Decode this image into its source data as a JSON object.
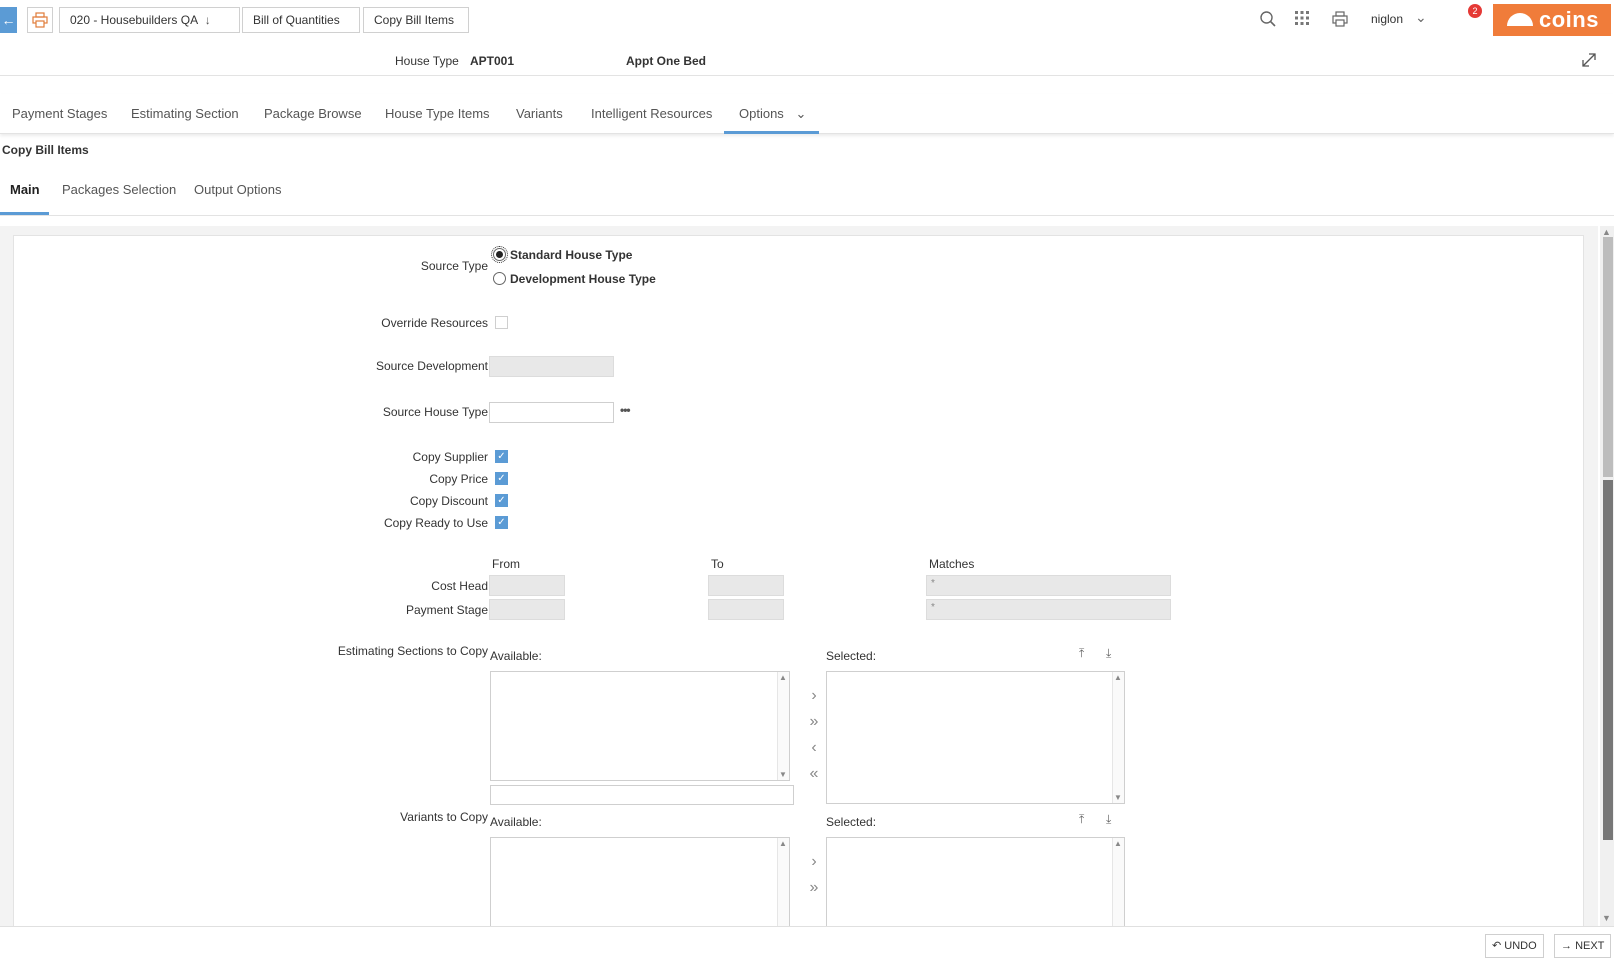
{
  "topbar": {
    "back_icon": "arrow-left-icon",
    "print_icon": "printer-icon",
    "breadcrumbs": [
      "020 - Housebuilders QA",
      "Bill of Quantities",
      "Copy Bill Items"
    ],
    "crumb1_chevron": "↓",
    "user": "niglon",
    "notification_count": "2",
    "logo_text": "coins",
    "brand_color": "#f07c3a"
  },
  "header": {
    "house_type_label": "House Type",
    "house_type_code": "APT001",
    "house_type_desc": "Appt One Bed"
  },
  "main_tabs": [
    "Payment Stages",
    "Estimating Section",
    "Package Browse",
    "House Type Items",
    "Variants",
    "Intelligent Resources",
    "Options"
  ],
  "section_title": "Copy Bill Items",
  "sub_tabs": [
    "Main",
    "Packages Selection",
    "Output Options"
  ],
  "form": {
    "source_type_label": "Source Type",
    "source_type_options": [
      "Standard House Type",
      "Development House Type"
    ],
    "source_type_selected": "Standard House Type",
    "override_resources_label": "Override Resources",
    "override_resources_checked": false,
    "source_development_label": "Source Development",
    "source_development_value": "",
    "source_house_type_label": "Source House Type",
    "source_house_type_value": "",
    "lookup_icon": "ellipsis-icon",
    "copy_options": [
      {
        "label": "Copy Supplier",
        "checked": true
      },
      {
        "label": "Copy Price",
        "checked": true
      },
      {
        "label": "Copy Discount",
        "checked": true
      },
      {
        "label": "Copy Ready to Use",
        "checked": true
      }
    ],
    "range_headers": {
      "from": "From",
      "to": "To",
      "matches": "Matches"
    },
    "cost_head_label": "Cost Head",
    "payment_stage_label": "Payment Stage",
    "cost_head_matches": "*",
    "payment_stage_matches": "*",
    "estimating_sections_label": "Estimating Sections to Copy",
    "variants_label": "Variants to Copy",
    "available_label": "Available:",
    "selected_label": "Selected:"
  },
  "footer": {
    "undo_label": "UNDO",
    "next_label": "NEXT"
  },
  "colors": {
    "accent": "#5b9bd5",
    "badge": "#e53935"
  }
}
